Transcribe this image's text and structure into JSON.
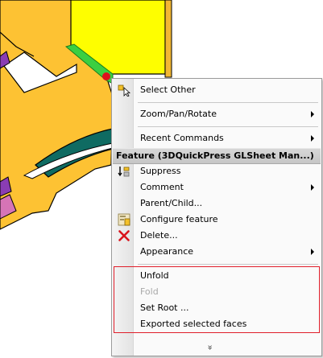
{
  "menu": {
    "items": [
      {
        "id": "select-other",
        "label": "Select Other"
      },
      {
        "id": "zoom-pan-rotate",
        "label": "Zoom/Pan/Rotate"
      },
      {
        "id": "recent-commands",
        "label": "Recent Commands"
      },
      {
        "id": "suppress",
        "label": "Suppress"
      },
      {
        "id": "comment",
        "label": "Comment"
      },
      {
        "id": "parent-child",
        "label": "Parent/Child..."
      },
      {
        "id": "configure-feature",
        "label": "Configure feature"
      },
      {
        "id": "delete",
        "label": "Delete..."
      },
      {
        "id": "appearance",
        "label": "Appearance"
      },
      {
        "id": "unfold",
        "label": "Unfold"
      },
      {
        "id": "fold",
        "label": "Fold",
        "disabled": true
      },
      {
        "id": "set-root",
        "label": "Set Root ..."
      },
      {
        "id": "exported-selected-faces",
        "label": "Exported selected faces"
      }
    ],
    "section_header": "Feature (3DQuickPress GLSheet Man...)",
    "expand_glyph": "»",
    "highlight_color": "#e01e2a"
  },
  "scene": {
    "colors": {
      "part_face": "#fdc233",
      "yellow_panel": "#fefe00",
      "teal_flange": "#0f6b62",
      "green_edge": "#3bcf41",
      "purple_part": "#8a3db3",
      "pink_part": "#d674b6",
      "selection_point": "#e0101c"
    }
  }
}
